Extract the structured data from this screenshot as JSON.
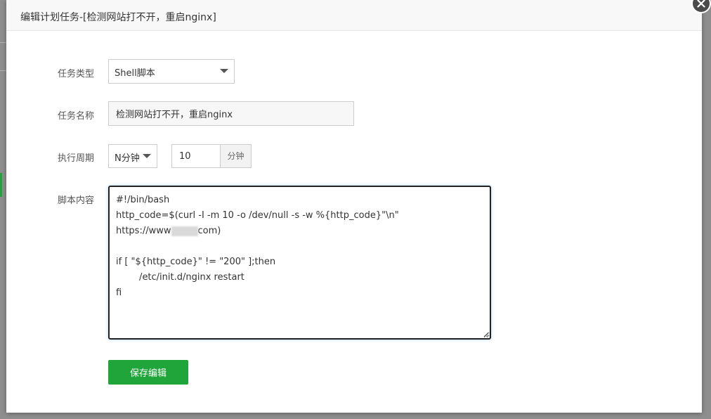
{
  "dialog": {
    "title": "编辑计划任务-[检测网站打不开，重启nginx]"
  },
  "form": {
    "task_type": {
      "label": "任务类型",
      "value": "Shell脚本"
    },
    "task_name": {
      "label": "任务名称",
      "value": "检测网站打不开，重启nginx"
    },
    "period": {
      "label": "执行周期",
      "mode": "N分钟",
      "value": "10",
      "unit": "分钟"
    },
    "script": {
      "label": "脚本内容",
      "lines": [
        "#!/bin/bash",
        "http_code=$(curl -I -m 10 -o /dev/null -s -w %{http_code}\"\\n\"",
        "https://www",
        "",
        "if [ \"${http_code}\" != \"200\" ];then",
        "        /etc/init.d/nginx restart",
        "fi"
      ],
      "url_tail": "com)"
    }
  },
  "actions": {
    "save_label": "保存编辑"
  },
  "colors": {
    "accent": "#20a53a",
    "close_bg": "#4b4b4b"
  }
}
